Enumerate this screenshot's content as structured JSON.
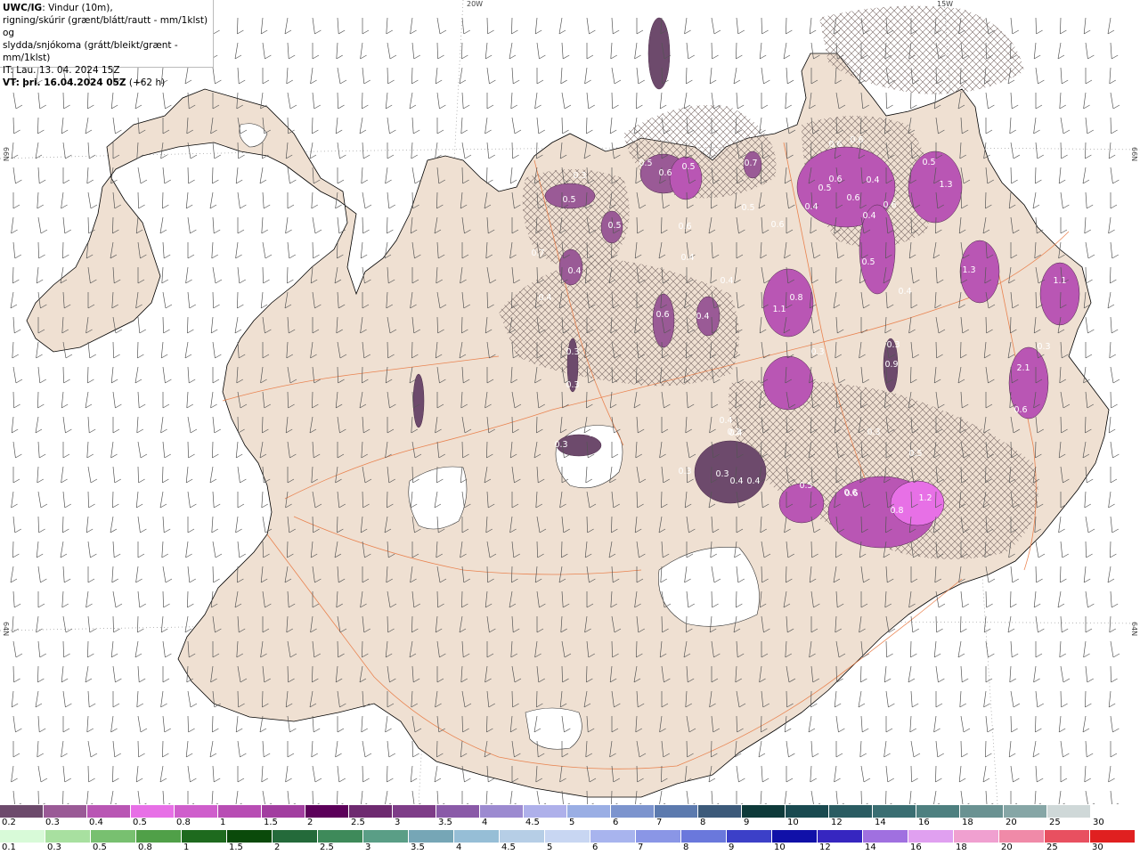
{
  "header": {
    "model": "UWC/IG",
    "title_rest": ": Vindur (10m),",
    "line2": "rigning/skúrir (grænt/blátt/rautt - mm/1klst) og",
    "line3": "slydda/snjókoma (grátt/bleikt/grænt - mm/1klst)",
    "it_line": "IT: Lau. 13. 04. 2024 15Z",
    "vt_label": "VT:",
    "vt_value": "þri. 16.04.2024 05Z",
    "vt_offset": "(+62 h)"
  },
  "grid_labels": {
    "top_20w": "20W",
    "top_15w": "15W",
    "left_66n": "66N",
    "right_66n": "66N",
    "left_64n": "64N",
    "right_64n": "64N"
  },
  "precip_labels": [
    "0.3",
    "0.5",
    "0.6",
    "0.5",
    "0.5",
    "0.5",
    "0.7",
    "0.4",
    "0.4",
    "0.6",
    "0.4",
    "0.4",
    "0.6",
    "0.4",
    "0.7",
    "0.5",
    "0.6",
    "0.6",
    "0.6",
    "0.5",
    "1.3",
    "0.6",
    "0.4",
    "0.6",
    "0.4",
    "0.4",
    "0.6",
    "0.5",
    "0.5",
    "0.4",
    "1.1",
    "0.8",
    "1.3",
    "1.1",
    "0.3",
    "2.1",
    "0.6",
    "0.3",
    "0.3",
    "0.9",
    "0.3",
    "0.3",
    "0.3",
    "0.3",
    "0.4",
    "0.4",
    "0.3",
    "0.3",
    "0.4",
    "0.5",
    "0.6",
    "1.2",
    "0.8",
    "0.3",
    "0.5",
    "0.5",
    "0.6",
    "0.4"
  ],
  "legend_snow": {
    "labels": [
      "0.2",
      "0.3",
      "0.4",
      "0.5",
      "0.8",
      "1",
      "1.5",
      "2",
      "2.5",
      "3",
      "3.5",
      "4",
      "4.5",
      "5",
      "6",
      "7",
      "8",
      "9",
      "10",
      "12",
      "14",
      "16",
      "18",
      "20",
      "25",
      "30"
    ],
    "colors": [
      "#6d4a6c",
      "#9a5a96",
      "#b956b4",
      "#e770e6",
      "#cf5ecc",
      "#b84db4",
      "#a23ea0",
      "#5c005a",
      "#6e2a70",
      "#7e3d88",
      "#8a5aa8",
      "#9c8ad0",
      "#aeb0ea",
      "#9aaee4",
      "#7c94ce",
      "#5c7aae",
      "#3c5a7a",
      "#0e3a3a",
      "#1a4a50",
      "#2a5c62",
      "#3a6e72",
      "#4e8080",
      "#6a9292",
      "#86a6a6",
      "#cfd8d8",
      "#ffffff"
    ]
  },
  "legend_rain": {
    "labels": [
      "0.1",
      "0.3",
      "0.5",
      "0.8",
      "1",
      "1.5",
      "2",
      "2.5",
      "3",
      "3.5",
      "4",
      "4.5",
      "5",
      "6",
      "7",
      "8",
      "9",
      "10",
      "12",
      "14",
      "16",
      "18",
      "20",
      "25",
      "30"
    ],
    "colors": [
      "#d8fad8",
      "#a8e0a0",
      "#78c070",
      "#50a048",
      "#1e6a1e",
      "#0a4a0a",
      "#246a3a",
      "#3e8a5a",
      "#5a9e86",
      "#76a6b6",
      "#96bed6",
      "#b6cee6",
      "#c8d6f2",
      "#a8b4ee",
      "#8a96e6",
      "#6a78dc",
      "#3c40c8",
      "#1010a8",
      "#3626c0",
      "#a070e0",
      "#e0a0f0",
      "#f0a0d0",
      "#f08aa8",
      "#e85060",
      "#e02020"
    ]
  }
}
